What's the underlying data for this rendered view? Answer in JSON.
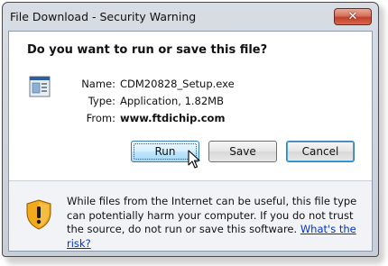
{
  "window": {
    "title": "File Download - Security Warning",
    "close_glyph": "✕"
  },
  "dialog": {
    "heading": "Do you want to run or save this file?",
    "file_icon": "executable-file-icon",
    "fields": [
      {
        "label": "Name:",
        "value": "CDM20828_Setup.exe"
      },
      {
        "label": "Type:",
        "value": "Application, 1.82MB"
      },
      {
        "label": "From:",
        "value": "www.ftdichip.com"
      }
    ],
    "buttons": {
      "run": "Run",
      "save": "Save",
      "cancel": "Cancel"
    }
  },
  "footer": {
    "icon": "warning-shield-icon",
    "warning_text": "While files from the Internet can be useful, this file type can potentially harm your computer. If you do not trust the source, do not run or save this software.",
    "risk_link": "What's the risk?"
  },
  "colors": {
    "link": "#0033cc",
    "shield_orange": "#f2a91a",
    "close_red": "#c2412a"
  }
}
